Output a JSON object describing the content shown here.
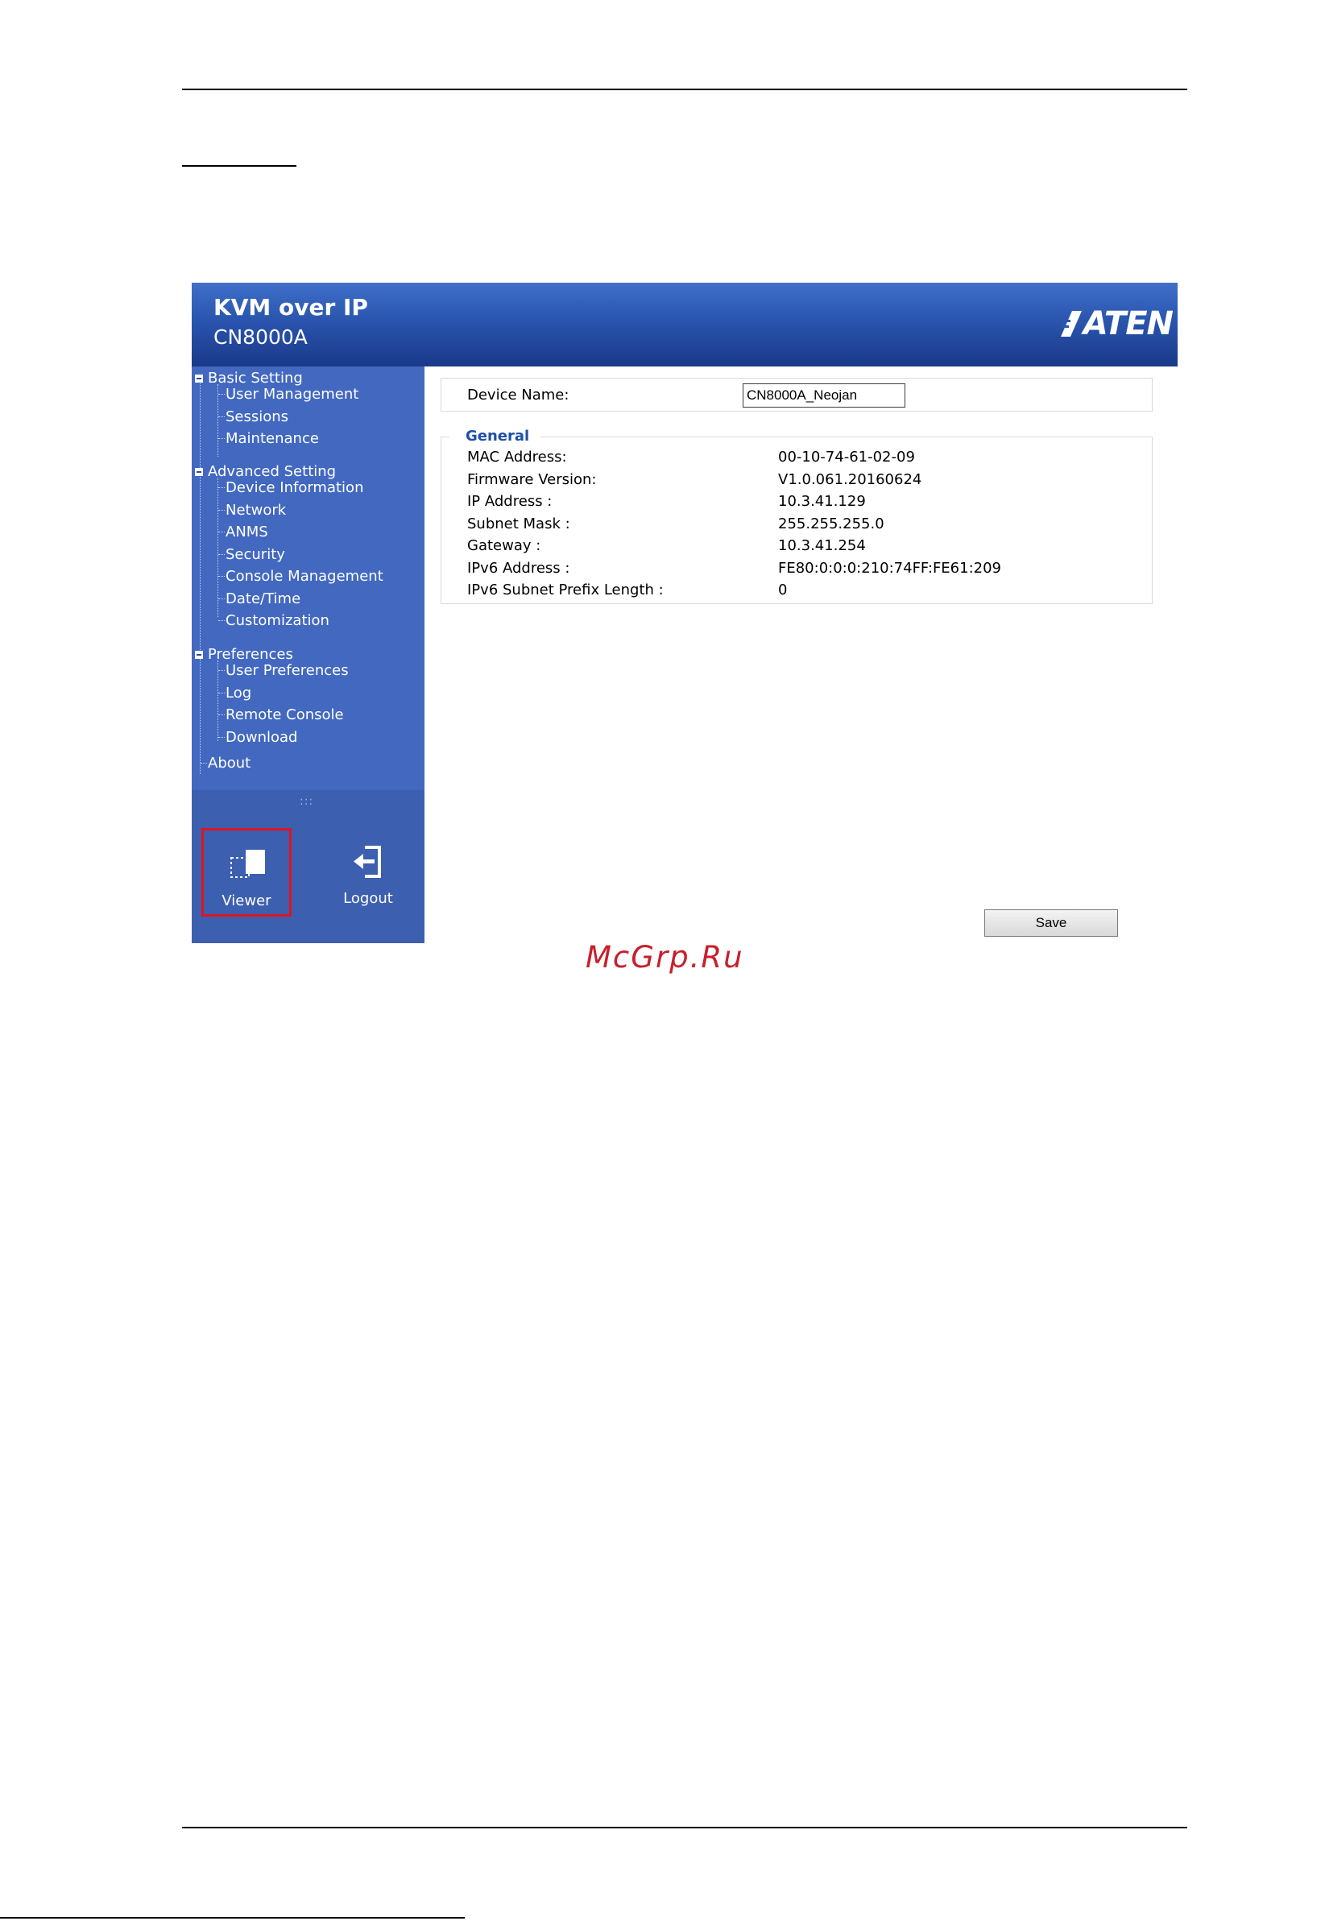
{
  "header": {
    "title": "KVM over IP",
    "subtitle": "CN8000A",
    "logo_text": "ATEN"
  },
  "sidebar": {
    "groups": [
      {
        "label": "Basic Setting",
        "items": [
          "User Management",
          "Sessions",
          "Maintenance"
        ]
      },
      {
        "label": "Advanced Setting",
        "items": [
          "Device Information",
          "Network",
          "ANMS",
          "Security",
          "Console Management",
          "Date/Time",
          "Customization"
        ]
      },
      {
        "label": "Preferences",
        "items": [
          "User Preferences",
          "Log",
          "Remote Console",
          "Download"
        ]
      }
    ],
    "about": "About",
    "grip": ":::",
    "dock": {
      "viewer": "Viewer",
      "logout": "Logout"
    }
  },
  "main": {
    "device_name_label": "Device Name:",
    "device_name_value": "CN8000A_Neojan",
    "general_title": "General",
    "rows": [
      {
        "label": "MAC Address:",
        "value": "00-10-74-61-02-09"
      },
      {
        "label": "Firmware Version:",
        "value": "V1.0.061.20160624"
      },
      {
        "label": "IP Address :",
        "value": "10.3.41.129"
      },
      {
        "label": "Subnet Mask :",
        "value": "255.255.255.0"
      },
      {
        "label": "Gateway :",
        "value": "10.3.41.254"
      },
      {
        "label": "IPv6 Address :",
        "value": "FE80:0:0:0:210:74FF:FE61:209"
      },
      {
        "label": "IPv6 Subnet Prefix Length :",
        "value": "0"
      }
    ],
    "save_label": "Save"
  },
  "watermark": "McGrp.Ru",
  "colors": {
    "header_blue": "#2a55ae",
    "sidebar_blue": "#4268c0",
    "highlight_red": "#e0141e"
  }
}
